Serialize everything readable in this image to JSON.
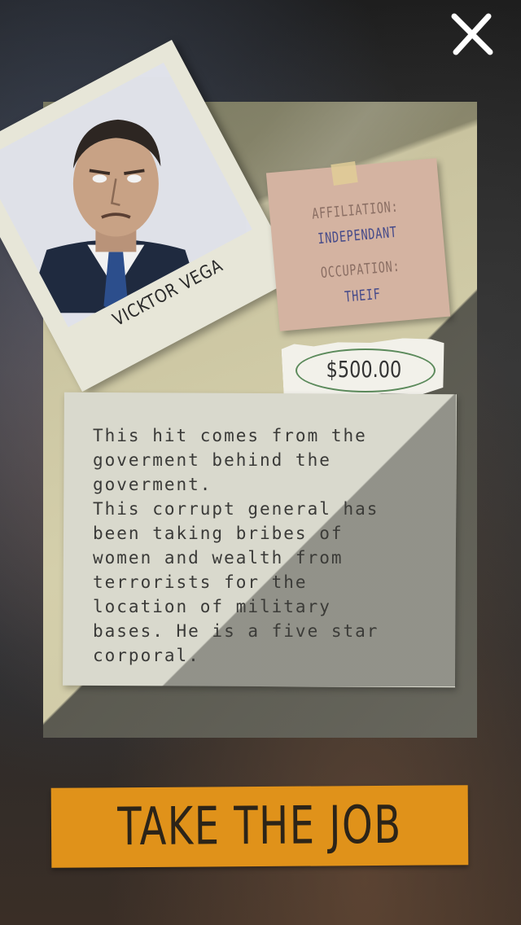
{
  "close_button": {
    "label": "X"
  },
  "target": {
    "name": "VICKTOR VEGA",
    "affiliation_label": "AFFILIATION:",
    "affiliation_value": "INDEPENDANT",
    "occupation_label": "OCCUPATION:",
    "occupation_value": "THEIF",
    "bounty": "$500.00",
    "description": "This hit comes from the\ngoverment behind the\ngoverment.\nThis corrupt general has\nbeen taking bribes of\nwomen and wealth from\nterrorists for the\nlocation of military\nbases. He is a five star\ncorporal."
  },
  "action_button": {
    "label": "TAKE THE JOB"
  },
  "colors": {
    "button": "#e0921a",
    "sticky_note": "#d4b3a1",
    "value_ink": "#454a8a",
    "money_circle": "#5b8a5b"
  }
}
